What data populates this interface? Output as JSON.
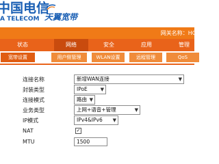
{
  "brand": {
    "logo_cn": "中国电信",
    "logo_en": "A TELECOM",
    "logo_brand": "天翼宽带"
  },
  "gateway": {
    "name_label": "网关名称：HG"
  },
  "menu": {
    "items": [
      {
        "label": "状态"
      },
      {
        "label": "网络"
      },
      {
        "label": "安全"
      },
      {
        "label": "应用"
      },
      {
        "label": "管理"
      }
    ]
  },
  "submenu": {
    "items": [
      {
        "label": "宽带设置"
      },
      {
        "label": "用户侧管理"
      },
      {
        "label": "WLAN设置"
      },
      {
        "label": "远程管理"
      },
      {
        "label": "QoS"
      }
    ]
  },
  "form": {
    "connection_name": {
      "label": "连接名称",
      "value": "新增WAN连接"
    },
    "encapsulation": {
      "label": "封装类型",
      "value": "IPoE"
    },
    "connection_mode": {
      "label": "连接模式",
      "value": "路由"
    },
    "service_type": {
      "label": "业务类型",
      "value": "上网+语音+管理"
    },
    "ip_mode": {
      "label": "IP模式",
      "value": "IPv4&IPv6"
    },
    "nat": {
      "label": "NAT",
      "checked": "✓"
    },
    "mtu": {
      "label": "MTU",
      "value": "1500"
    }
  },
  "colors": {
    "brand_blue": "#1a5fb4",
    "orange": "#f07a17",
    "orange_dark": "#e9631a"
  }
}
